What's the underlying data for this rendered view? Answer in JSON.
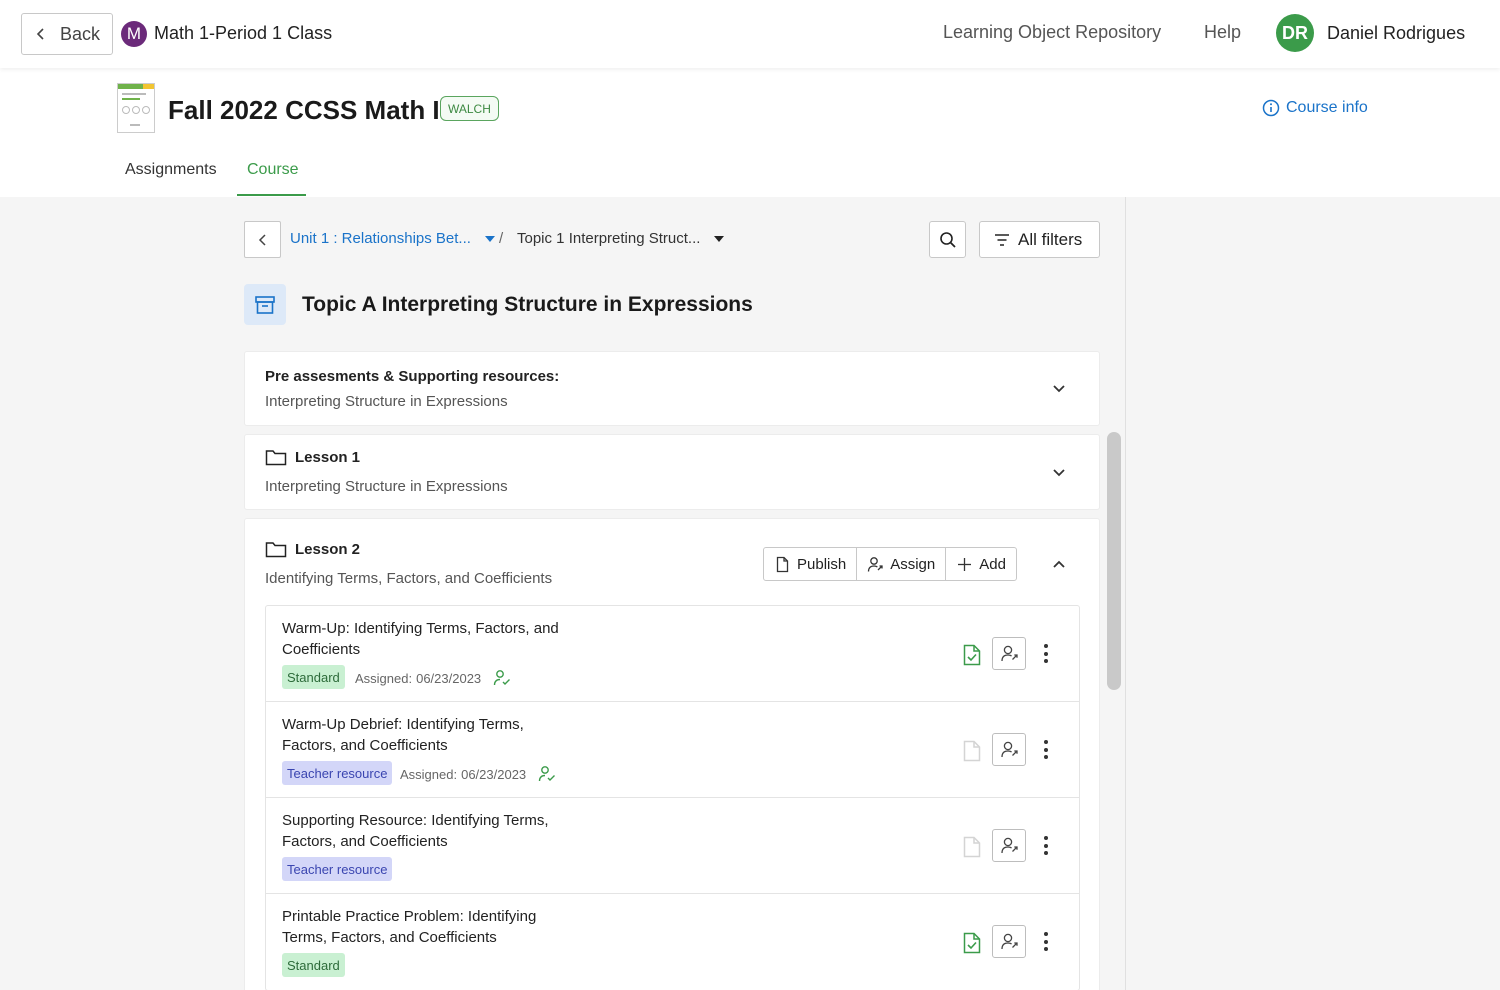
{
  "topbar": {
    "back_label": "Back",
    "class_badge": "M",
    "class_name": "Math 1-Period 1 Class",
    "repo_link": "Learning Object Repository",
    "help_link": "Help",
    "avatar_initials": "DR",
    "user_name": "Daniel Rodrigues"
  },
  "course": {
    "title": "Fall 2022 CCSS Math I",
    "publisher_badge": "WALCH",
    "course_info": "Course info",
    "tabs": [
      {
        "label": "Assignments",
        "active": false
      },
      {
        "label": "Course",
        "active": true
      }
    ]
  },
  "breadcrumb": {
    "unit": "Unit 1 : Relationships Bet...",
    "separator": "/",
    "topic": "Topic 1 Interpreting Struct..."
  },
  "toolbar": {
    "filters_label": "All filters"
  },
  "topic": {
    "title": "Topic A Interpreting Structure in Expressions"
  },
  "sections": [
    {
      "title": "Pre assesments & Supporting resources:",
      "subtitle": "Interpreting Structure in Expressions",
      "expanded": false
    },
    {
      "title": "Lesson 1",
      "subtitle": "Interpreting Structure in Expressions",
      "expanded": false
    },
    {
      "title": "Lesson 2",
      "subtitle": "Identifying Terms, Factors, and Coefficients",
      "expanded": true,
      "actions": {
        "publish": "Publish",
        "assign": "Assign",
        "add": "Add"
      },
      "items": [
        {
          "title": "Warm-Up: Identifying Terms, Factors, and Coefficients",
          "tag": "Standard",
          "tag_type": "standard",
          "assigned_label": "Assigned:",
          "assigned_date": "06/23/2023",
          "published": true
        },
        {
          "title": "Warm-Up Debrief: Identifying Terms, Factors, and Coefficients",
          "tag": "Teacher resource",
          "tag_type": "teacher",
          "assigned_label": "Assigned:",
          "assigned_date": "06/23/2023",
          "published": false
        },
        {
          "title": "Supporting Resource: Identifying Terms, Factors, and Coefficients",
          "tag": "Teacher resource",
          "tag_type": "teacher",
          "published": false
        },
        {
          "title": "Printable Practice Problem: Identifying Terms, Factors, and Coefficients",
          "tag": "Standard",
          "tag_type": "standard",
          "published": true
        }
      ]
    }
  ],
  "colors": {
    "accent_green": "#3b9b4a",
    "link_blue": "#1a73c9",
    "class_purple": "#6b2a7a",
    "standard_tag_bg": "#c9f0d2",
    "teacher_tag_bg": "#d3d6f8"
  },
  "icons": {
    "back": "chevron-left-icon",
    "search": "search-icon",
    "filter": "filter-lines-icon",
    "topic": "archive-box-icon",
    "folder": "folder-icon",
    "expand": "chevron-down-icon",
    "collapse": "chevron-up-icon",
    "publish": "document-icon",
    "assign": "user-arrow-icon",
    "add": "plus-icon",
    "published": "document-check-icon",
    "assigned": "user-check-icon",
    "more": "kebab-icon"
  }
}
